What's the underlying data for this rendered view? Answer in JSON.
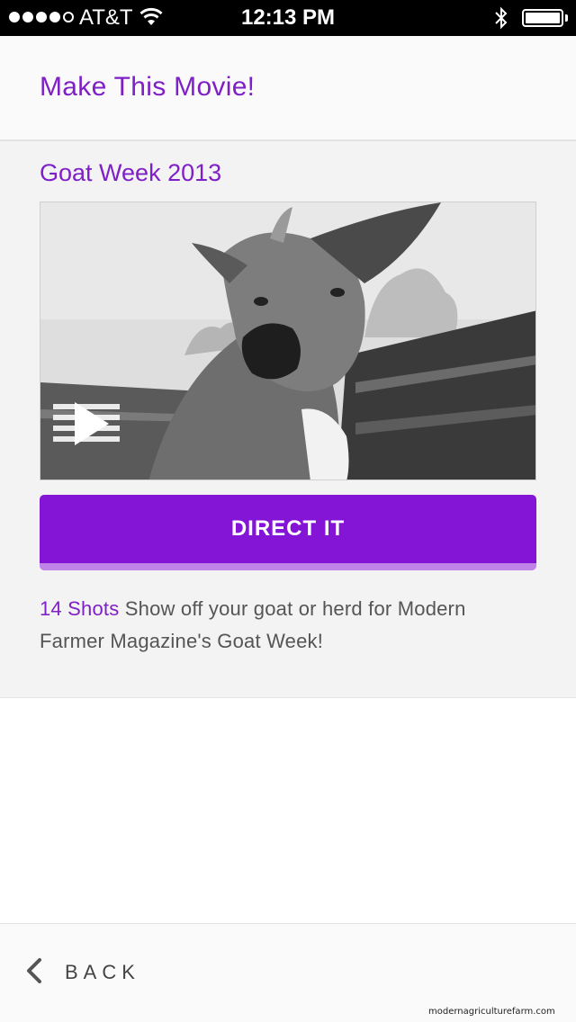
{
  "status_bar": {
    "carrier": "AT&T",
    "time": "12:13 PM",
    "signal_bars_filled": 4,
    "signal_bars_total": 5,
    "icons": [
      "wifi-icon",
      "bluetooth-icon",
      "battery-icon"
    ]
  },
  "header": {
    "title": "Make This Movie!"
  },
  "movie": {
    "title": "Goat Week 2013",
    "thumbnail_icon": "play-icon",
    "direct_button_label": "DIRECT IT",
    "shots_label": "14 Shots",
    "description": " Show off your goat or herd for Modern Farmer Magazine's Goat Week!"
  },
  "footer": {
    "back_label": "BACK",
    "back_icon": "chevron-left-icon"
  },
  "watermark": "modernagriculturefarm.com",
  "colors": {
    "accent": "#7f1fc6",
    "button": "#8414d6",
    "button_bottom": "#c083e8",
    "background_card": "#f3f3f3"
  }
}
